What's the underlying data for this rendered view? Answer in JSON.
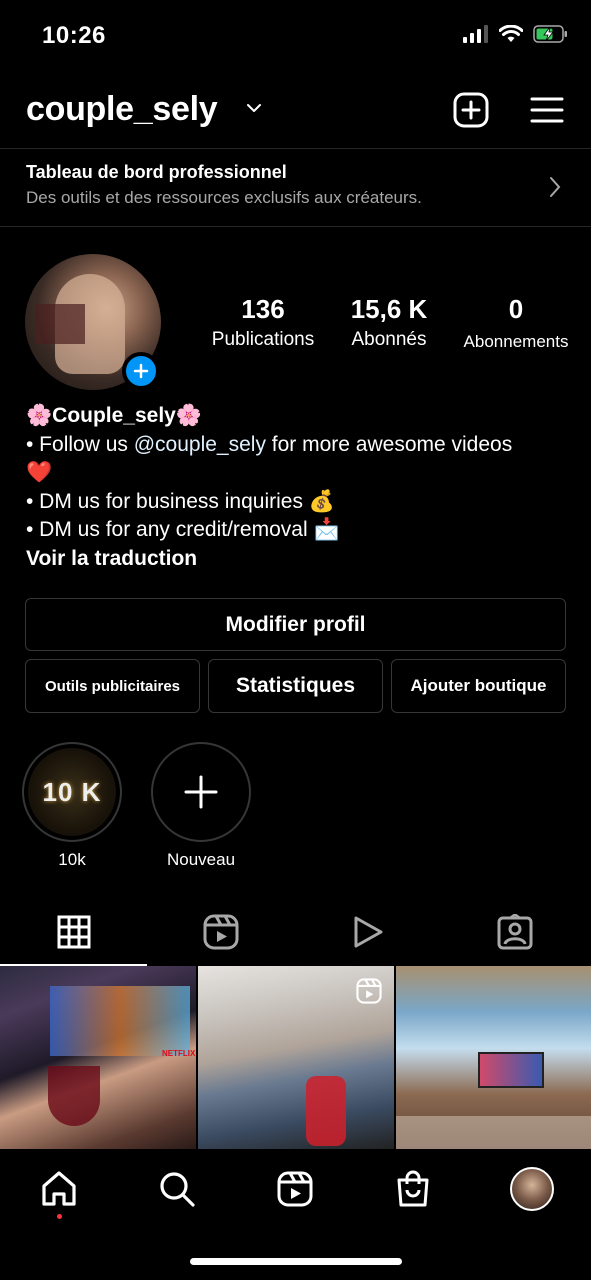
{
  "status": {
    "time": "10:26"
  },
  "header": {
    "username": "couple_sely"
  },
  "pro_dashboard": {
    "title": "Tableau de bord professionnel",
    "subtitle": "Des outils et des ressources exclusifs aux créateurs."
  },
  "stats": [
    {
      "value": "136",
      "label": "Publications"
    },
    {
      "value": "15,6 K",
      "label": "Abonnés"
    },
    {
      "value": "0",
      "label": "Abonnements"
    }
  ],
  "bio": {
    "name": "🌸Couple_sely🌸",
    "line1_prefix": "• Follow us ",
    "line1_mention": "@couple_sely",
    "line1_suffix": " for more awesome videos",
    "line1_emoji": "❤️",
    "line2": "• DM us for business inquiries 💰",
    "line3": "• DM us for any credit/removal 📩",
    "translate": "Voir la traduction"
  },
  "buttons": {
    "edit_profile": "Modifier profil",
    "ad_tools": "Outils publicitaires",
    "insights": "Statistiques",
    "add_shop": "Ajouter boutique"
  },
  "highlights": [
    {
      "cover_text": "10 K",
      "label": "10k"
    },
    {
      "label": "Nouveau"
    }
  ],
  "tabs": [
    {
      "icon": "grid-icon",
      "active": true
    },
    {
      "icon": "reels-icon",
      "active": false
    },
    {
      "icon": "video-play-icon",
      "active": false
    },
    {
      "icon": "tagged-icon",
      "active": false
    }
  ],
  "grid_posts": [
    {
      "type": "photo",
      "overlay_text": "NETFLIX"
    },
    {
      "type": "reel"
    },
    {
      "type": "photo"
    }
  ],
  "bottom_nav": [
    {
      "icon": "home-icon",
      "active": true
    },
    {
      "icon": "search-icon"
    },
    {
      "icon": "reels-nav-icon"
    },
    {
      "icon": "shop-icon"
    },
    {
      "icon": "profile-avatar"
    }
  ],
  "colors": {
    "accent_blue": "#0095f6",
    "notification_dot": "#ff3040",
    "battery_charging": "#34c759"
  }
}
